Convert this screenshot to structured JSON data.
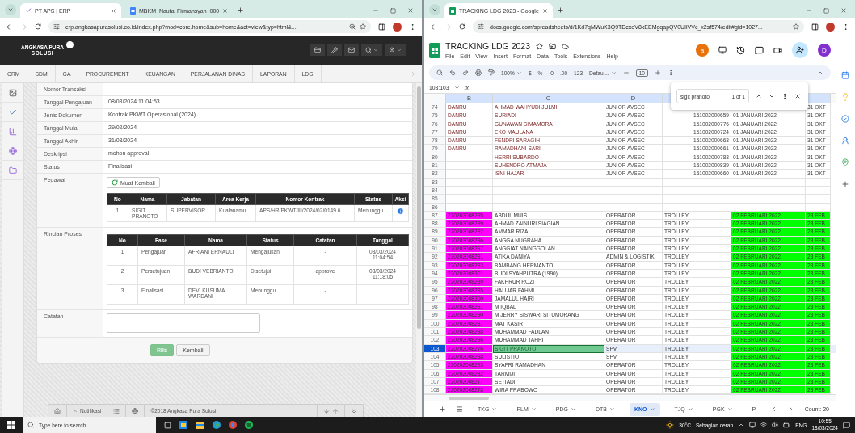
{
  "left": {
    "tabs": [
      {
        "title": "PT APS | ERP",
        "selected": true
      },
      {
        "title": "MBKM_Naufal Firmansyah_000",
        "selected": false
      }
    ],
    "url": "erp.angkasapurasolusi.co.id/index.php?mod=core.home&sub=home&act=view&typ=html&...",
    "logo": {
      "name": "ANGKASA PURA",
      "sub": "SOLUSI"
    },
    "menu": [
      "CRM",
      "SDM",
      "GA",
      "PROCUREMENT",
      "KEUANGAN",
      "PERJALANAN DINAS",
      "LAPORAN",
      "LDG"
    ],
    "form": [
      {
        "label": "Nomor Transaksi"
      },
      {
        "label": "Tanggal Pengajuan",
        "value": "08/03/2024 11:04:53"
      },
      {
        "label": "Jenis Dokumen",
        "value": "Kontrak PKWT Operasional (2024)"
      },
      {
        "label": "Tanggal Mulai",
        "value": "29/02/2024"
      },
      {
        "label": "Tanggal Akhir",
        "value": "31/03/2024"
      },
      {
        "label": "Deskripsi",
        "value": "mohon approval"
      },
      {
        "label": "Status",
        "value": "Finalisasi"
      }
    ],
    "pegawai": {
      "label": "Pegawai",
      "button": "Muat Kembali",
      "columns": [
        "No",
        "Nama",
        "Jabatan",
        "Area Kerja",
        "Nomor Kontrak",
        "Status",
        "Aksi"
      ],
      "rows": [
        [
          "1",
          "SIGIT PRANOTO",
          "SUPERVISOR",
          "Kualanamu",
          "APS/HR/PKWT/III/2024/02/0149.6",
          "Menunggu"
        ]
      ]
    },
    "proses": {
      "label": "Rincian Proses",
      "columns": [
        "No",
        "Fase",
        "Nama",
        "Status",
        "Catatan",
        "Tanggal"
      ],
      "rows": [
        [
          "1",
          "Pengajuan",
          "AFRIANI ERNAULI",
          "Mengajukan",
          "-",
          "08/03/2024 11:04:54"
        ],
        [
          "2",
          "Persetujuan",
          "BUDI VEBRIANTO",
          "Disetujui",
          "approve",
          "08/03/2024 11:18:05"
        ],
        [
          "3",
          "Finalisasi",
          "DEVI KUSUMA WARDANI",
          "Menunggu",
          "-",
          null
        ]
      ]
    },
    "catatan": {
      "label": "Catatan"
    },
    "buttons": [
      {
        "label": "Rilis",
        "kind": "primary"
      },
      {
        "label": "Kembali",
        "kind": "default"
      }
    ],
    "footer": {
      "notif": "Notifikasi",
      "copyright": "©2018 Angkasa Pura Solusi"
    }
  },
  "right": {
    "tabs": [
      {
        "title": "TRACKING LDG 2023 - Google",
        "selected": true
      }
    ],
    "url": "docs.google.com/spreadsheets/d/1Kd7qMWuK3Q9TDcxoV8kEEMgqapQV0UIiVVc_x2sf574/edit#gid=1027...",
    "title": "TRACKING LDG 2023",
    "avatar": "a",
    "account": "D",
    "menus": [
      "File",
      "Edit",
      "View",
      "Insert",
      "Format",
      "Data",
      "Tools",
      "Extensions",
      "Help"
    ],
    "toolbar": {
      "zoom": "100%",
      "currency": "$",
      "percent": "%",
      "dec_less": ".0",
      "dec_more": ".00",
      "number": "123",
      "font": "Defaul...",
      "size": "10"
    },
    "namebox": "103:103",
    "fx": "fx",
    "find": {
      "query": "sigit pranoto",
      "count": "1 of 1"
    },
    "headers": [
      "B",
      "C",
      "D"
    ],
    "rows": [
      {
        "number": "74",
        "kind": "staff",
        "selected": false,
        "cells": [
          "DANRU",
          "AHMAD WAHYUDI JULMI",
          "JUNIOR AVSEC",
          null,
          null,
          "31 OKT"
        ]
      },
      {
        "number": "75",
        "kind": "staff",
        "selected": false,
        "cells": [
          "DANRU",
          "SURIADI",
          "JUNIOR AVSEC",
          "151002000659",
          "01 JANUARI 2022",
          "31 OKT"
        ]
      },
      {
        "number": "76",
        "kind": "staff",
        "selected": false,
        "cells": [
          "DANRU",
          "GUNAWAN SIMAMORA",
          "JUNIOR AVSEC",
          "151002000776",
          "01 JANUARI 2022",
          "31 OKT"
        ]
      },
      {
        "number": "77",
        "kind": "staff",
        "selected": false,
        "cells": [
          "DANRU",
          "EKO MAULANA",
          "JUNIOR AVSEC",
          "151002000724",
          "01 JANUARI 2022",
          "31 OKT"
        ]
      },
      {
        "number": "78",
        "kind": "staff",
        "selected": false,
        "cells": [
          "DANRU",
          "FENDRI SARAGIH",
          "JUNIOR AVSEC",
          "151002000663",
          "01 JANUARI 2022",
          "31 OKT"
        ]
      },
      {
        "number": "79",
        "kind": "staff",
        "selected": false,
        "cells": [
          "DANRU",
          "RAMADHANI SARI",
          "JUNIOR AVSEC",
          "151002000661",
          "01 JANUARI 2022",
          "31 OKT"
        ]
      },
      {
        "number": "80",
        "kind": "staff",
        "selected": false,
        "cells": [
          null,
          "HERRI SUBARDO",
          "JUNIOR AVSEC",
          "151002000783",
          "01 JANUARI 2022",
          "31 OKT"
        ]
      },
      {
        "number": "81",
        "kind": "staff",
        "selected": false,
        "cells": [
          null,
          "SUHENDRO ATMAJA",
          "JUNIOR AVSEC",
          "151002000839",
          "01 JANUARI 2022",
          "31 OKT"
        ]
      },
      {
        "number": "82",
        "kind": "staff",
        "selected": false,
        "cells": [
          null,
          "ISNI HAJAR",
          "JUNIOR AVSEC",
          "151002000660",
          "01 JANUARI 2022",
          "31 OKT"
        ]
      },
      {
        "number": "83",
        "kind": "blank",
        "selected": false
      },
      {
        "number": "84",
        "kind": "blank",
        "selected": false
      },
      {
        "number": "85",
        "kind": "blank",
        "selected": false
      },
      {
        "number": "86",
        "kind": "blank",
        "selected": false
      },
      {
        "number": "87",
        "kind": "tracked",
        "selected": false,
        "cells": [
          "220202008295",
          "ABDUL MUIS",
          "OPERATOR",
          "TROLLEY",
          "02 FEBRUARI 2022",
          "28 FEB"
        ]
      },
      {
        "number": "88",
        "kind": "tracked",
        "selected": false,
        "cells": [
          "220202008299",
          "AHMAD ZAINURI SIAGIAN",
          "OPERATOR",
          "TROLLEY",
          "02 FEBRUARI 2022",
          "28 FEB"
        ]
      },
      {
        "number": "89",
        "kind": "tracked",
        "selected": false,
        "cells": [
          "220202008292",
          "AMMAR RIZAL",
          "OPERATOR",
          "TROLLEY",
          "02 FEBRUARI 2022",
          "28 FEB"
        ]
      },
      {
        "number": "90",
        "kind": "tracked",
        "selected": false,
        "cells": [
          "220202008286",
          "ANGGA NUGRAHA",
          "OPERATOR",
          "TROLLEY",
          "02 FEBRUARI 2022",
          "28 FEB"
        ]
      },
      {
        "number": "91",
        "kind": "tracked",
        "selected": false,
        "cells": [
          "220202008297",
          "ANGGIAT NAINGGOLAN",
          "OPERATOR",
          "TROLLEY",
          "02 FEBRUARI 2022",
          "28 FEB"
        ]
      },
      {
        "number": "92",
        "kind": "tracked",
        "selected": false,
        "cells": [
          "220202008281",
          "ATIKA DANIYA",
          "ADMIN & LOGISTIK",
          "TROLLEY",
          "02 FEBRUARI 2022",
          "28 FEB"
        ]
      },
      {
        "number": "93",
        "kind": "tracked",
        "selected": false,
        "cells": [
          "220202008283",
          "BAMBANG HERMANTO",
          "OPERATOR",
          "TROLLEY",
          "02 FEBRUARI 2022",
          "28 FEB"
        ]
      },
      {
        "number": "94",
        "kind": "tracked",
        "selected": false,
        "cells": [
          "220202008301",
          "BUDI SYAHPUTRA (1990)",
          "OPERATOR",
          "TROLLEY",
          "02 FEBRUARI 2022",
          "28 FEB"
        ]
      },
      {
        "number": "95",
        "kind": "tracked",
        "selected": false,
        "cells": [
          "220202008289",
          "FAKHRUR ROZI",
          "OPERATOR",
          "TROLLEY",
          "02 FEBRUARI 2022",
          "28 FEB"
        ]
      },
      {
        "number": "96",
        "kind": "tracked",
        "selected": false,
        "cells": [
          "220202008285",
          "HALIJAR FAHMI",
          "OPERATOR",
          "TROLLEY",
          "02 FEBRUARI 2022",
          "28 FEB"
        ]
      },
      {
        "number": "97",
        "kind": "tracked",
        "selected": false,
        "cells": [
          "220202008300",
          "JAMALUL HAIRI",
          "OPERATOR",
          "TROLLEY",
          "02 FEBRUARI 2022",
          "28 FEB"
        ]
      },
      {
        "number": "98",
        "kind": "tracked",
        "selected": false,
        "cells": [
          "220202008291",
          "M IQBAL",
          "OPERATOR",
          "TROLLEY",
          "02 FEBRUARI 2022",
          "28 FEB"
        ]
      },
      {
        "number": "99",
        "kind": "tracked",
        "selected": false,
        "cells": [
          "220202008280",
          "M JERRY SISWARI SITUMORANG",
          "OPERATOR",
          "TROLLEY",
          "02 FEBRUARI 2022",
          "28 FEB"
        ]
      },
      {
        "number": "100",
        "kind": "tracked",
        "selected": false,
        "cells": [
          "220202008287",
          "MAT KASIR",
          "OPERATOR",
          "TROLLEY",
          "02 FEBRUARI 2022",
          "28 FEB"
        ]
      },
      {
        "number": "101",
        "kind": "tracked",
        "selected": false,
        "cells": [
          "220202008298",
          "MUHAMMAD FADLAN",
          "OPERATOR",
          "TROLLEY",
          "02 FEBRUARI 2022",
          "28 FEB"
        ]
      },
      {
        "number": "102",
        "kind": "tracked",
        "selected": false,
        "cells": [
          "220202008296",
          "MUHAMMAD TAHRI",
          "OPERATOR",
          "TROLLEY",
          "02 FEBRUARI 2022",
          "28 FEB"
        ]
      },
      {
        "number": "103",
        "kind": "tracked",
        "selected": true,
        "cells": [
          "220202008276",
          "SIGIT PRANOTO",
          "SPV",
          "TROLLEY",
          "02 FEBRUARI 2022",
          "28 FEB"
        ]
      },
      {
        "number": "104",
        "kind": "tracked",
        "selected": false,
        "cells": [
          "220202008288",
          "SULISTIO",
          "SPV",
          "TROLLEY",
          "02 FEBRUARI 2022",
          "28 FEB"
        ]
      },
      {
        "number": "105",
        "kind": "tracked",
        "selected": false,
        "cells": [
          "220202008293",
          "SYAFRI RAMADHAN",
          "OPERATOR",
          "TROLLEY",
          "02 FEBRUARI 2022",
          "28 FEB"
        ]
      },
      {
        "number": "106",
        "kind": "tracked",
        "selected": false,
        "cells": [
          "220202008282",
          "TARMIJI",
          "OPERATOR",
          "TROLLEY",
          "02 FEBRUARI 2022",
          "28 FEB"
        ]
      },
      {
        "number": "107",
        "kind": "tracked",
        "selected": false,
        "cells": [
          "220202008277",
          "SETIADI",
          "OPERATOR",
          "TROLLEY",
          "02 FEBRUARI 2022",
          "28 FEB"
        ]
      },
      {
        "number": "108",
        "kind": "tracked",
        "selected": false,
        "cells": [
          "220202008278",
          "WIRA PRABOWO",
          "OPERATOR",
          "TROLLEY",
          "02 FEBRUARI 2022",
          "28 FEB"
        ]
      }
    ],
    "sheet_tabs": [
      {
        "label": "TKG",
        "selected": false
      },
      {
        "label": "PLM",
        "selected": false
      },
      {
        "label": "PDG",
        "selected": false
      },
      {
        "label": "DTB",
        "selected": false
      },
      {
        "label": "KNO",
        "selected": true
      },
      {
        "label": "TJQ",
        "selected": false
      },
      {
        "label": "PGK",
        "selected": false
      },
      {
        "label": "P",
        "selected": false
      }
    ],
    "count": "Count: 20"
  },
  "taskbar": {
    "search": "Type here to search",
    "temp": "30°C",
    "weather": "Sebagian cerah",
    "lang": "ENG",
    "time": "10:55",
    "date": "18/03/2024"
  }
}
